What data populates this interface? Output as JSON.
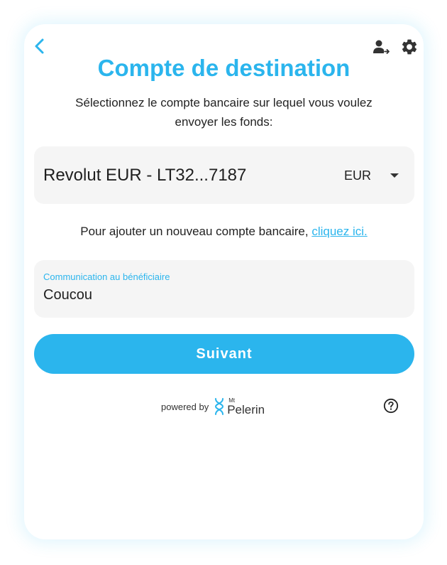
{
  "header": {
    "title": "Compte de destination",
    "subtitle": "Sélectionnez le compte bancaire sur lequel vous voulez envoyer les fonds:",
    "back_icon": "chevron-left-icon",
    "user_icon": "user-transfer-icon",
    "settings_icon": "gear-icon"
  },
  "account_select": {
    "selected_account": "Revolut EUR - LT32...7187",
    "currency": "EUR"
  },
  "add_account": {
    "text": "Pour ajouter un nouveau compte bancaire, ",
    "link_label": "cliquez ici."
  },
  "communication": {
    "label": "Communication au bénéficiaire",
    "value": "Coucou"
  },
  "actions": {
    "next_label": "Suivant"
  },
  "footer": {
    "powered_by": "powered by",
    "brand_prefix": "Mt",
    "brand_name": "Pelerin",
    "help_icon": "help-circle-icon"
  },
  "colors": {
    "accent": "#2bb5ed",
    "field_bg": "#f5f5f5",
    "text": "#222222"
  }
}
